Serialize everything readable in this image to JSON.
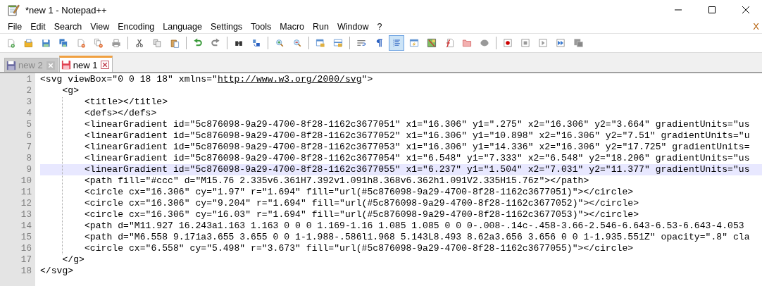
{
  "window": {
    "title": "*new 1 - Notepad++"
  },
  "menu": [
    {
      "label": "File"
    },
    {
      "label": "Edit"
    },
    {
      "label": "Search"
    },
    {
      "label": "View"
    },
    {
      "label": "Encoding"
    },
    {
      "label": "Language"
    },
    {
      "label": "Settings"
    },
    {
      "label": "Tools"
    },
    {
      "label": "Macro"
    },
    {
      "label": "Run"
    },
    {
      "label": "Window"
    },
    {
      "label": "?"
    }
  ],
  "close_document": "X",
  "toolbar": [
    {
      "buttons": [
        {
          "kind": "new",
          "selected": false
        },
        {
          "kind": "open",
          "selected": false
        },
        {
          "kind": "save",
          "selected": false
        },
        {
          "kind": "saveall",
          "selected": false
        },
        {
          "kind": "close",
          "selected": false
        },
        {
          "kind": "closeall",
          "selected": false
        },
        {
          "kind": "print",
          "selected": false
        }
      ]
    },
    {
      "buttons": [
        {
          "kind": "cut",
          "selected": false
        },
        {
          "kind": "copy",
          "selected": false
        },
        {
          "kind": "paste",
          "selected": false
        }
      ]
    },
    {
      "buttons": [
        {
          "kind": "undo",
          "selected": false
        },
        {
          "kind": "redo",
          "selected": false
        }
      ]
    },
    {
      "buttons": [
        {
          "kind": "find",
          "selected": false
        },
        {
          "kind": "replace",
          "selected": false
        }
      ]
    },
    {
      "buttons": [
        {
          "kind": "zoomin",
          "selected": false
        },
        {
          "kind": "zoomout",
          "selected": false
        }
      ]
    },
    {
      "buttons": [
        {
          "kind": "syncv",
          "selected": false
        },
        {
          "kind": "synch",
          "selected": false
        }
      ]
    },
    {
      "buttons": [
        {
          "kind": "wrap",
          "selected": false
        },
        {
          "kind": "pilcrow",
          "selected": false
        },
        {
          "kind": "indent",
          "selected": true
        },
        {
          "kind": "udl",
          "selected": false
        },
        {
          "kind": "docmap",
          "selected": false
        },
        {
          "kind": "funclist",
          "selected": false
        },
        {
          "kind": "folder",
          "selected": false
        },
        {
          "kind": "monitor",
          "selected": false
        }
      ]
    },
    {
      "buttons": [
        {
          "kind": "record",
          "selected": false
        },
        {
          "kind": "stop",
          "selected": false
        },
        {
          "kind": "play",
          "selected": false
        },
        {
          "kind": "playmulti",
          "selected": false
        },
        {
          "kind": "savemacro",
          "selected": false
        }
      ]
    }
  ],
  "tabs": [
    {
      "label": "new 2",
      "selected": false,
      "modified": false
    },
    {
      "label": "new 1",
      "selected": true,
      "modified": true
    }
  ],
  "lines": [
    {
      "number": "1",
      "selected": false,
      "segments": [
        {
          "kind": "code",
          "text": "<svg viewBox=\"0 0 18 18\" xmlns=\""
        },
        {
          "kind": "link",
          "text": "http://www.w3.org/2000/svg"
        },
        {
          "kind": "code",
          "text": "\">"
        }
      ]
    },
    {
      "number": "2",
      "selected": false,
      "segments": [
        {
          "kind": "code",
          "text": "    <g>"
        }
      ]
    },
    {
      "number": "3",
      "selected": false,
      "segments": [
        {
          "kind": "code",
          "text": "        <title></title>"
        }
      ]
    },
    {
      "number": "4",
      "selected": false,
      "segments": [
        {
          "kind": "code",
          "text": "        <defs></defs>"
        }
      ]
    },
    {
      "number": "5",
      "selected": false,
      "segments": [
        {
          "kind": "code",
          "text": "        <linearGradient id=\"5c876098-9a29-4700-8f28-1162c3677051\" x1=\"16.306\" y1=\".275\" x2=\"16.306\" y2=\"3.664\" gradientUnits=\"us"
        }
      ]
    },
    {
      "number": "6",
      "selected": false,
      "segments": [
        {
          "kind": "code",
          "text": "        <linearGradient id=\"5c876098-9a29-4700-8f28-1162c3677052\" x1=\"16.306\" y1=\"10.898\" x2=\"16.306\" y2=\"7.51\" gradientUnits=\"u"
        }
      ]
    },
    {
      "number": "7",
      "selected": false,
      "segments": [
        {
          "kind": "code",
          "text": "        <linearGradient id=\"5c876098-9a29-4700-8f28-1162c3677053\" x1=\"16.306\" y1=\"14.336\" x2=\"16.306\" y2=\"17.725\" gradientUnits="
        }
      ]
    },
    {
      "number": "8",
      "selected": false,
      "segments": [
        {
          "kind": "code",
          "text": "        <linearGradient id=\"5c876098-9a29-4700-8f28-1162c3677054\" x1=\"6.548\" y1=\"7.333\" x2=\"6.548\" y2=\"18.206\" gradientUnits=\"us"
        }
      ]
    },
    {
      "number": "9",
      "selected": true,
      "segments": [
        {
          "kind": "code",
          "text": "        <linearGradient id=\"5c876098-9a29-4700-8f28-1162c3677055\" x1=\"6.237\" y1=\"1.504\" x2=\"7.031\" y2=\"11.377\" gradientUnits=\"us"
        }
      ]
    },
    {
      "number": "10",
      "selected": false,
      "segments": [
        {
          "kind": "code",
          "text": "        <path fill=\"#ccc\" d=\"M15.76 2.335v6.361H7.392v1.091h8.368v6.362h1.091V2.335H15.76z\"></path>"
        }
      ]
    },
    {
      "number": "11",
      "selected": false,
      "segments": [
        {
          "kind": "code",
          "text": "        <circle cx=\"16.306\" cy=\"1.97\" r=\"1.694\" fill=\"url(#5c876098-9a29-4700-8f28-1162c3677051)\"></circle>"
        }
      ]
    },
    {
      "number": "12",
      "selected": false,
      "segments": [
        {
          "kind": "code",
          "text": "        <circle cx=\"16.306\" cy=\"9.204\" r=\"1.694\" fill=\"url(#5c876098-9a29-4700-8f28-1162c3677052)\"></circle>"
        }
      ]
    },
    {
      "number": "13",
      "selected": false,
      "segments": [
        {
          "kind": "code",
          "text": "        <circle cx=\"16.306\" cy=\"16.03\" r=\"1.694\" fill=\"url(#5c876098-9a29-4700-8f28-1162c3677053)\"></circle>"
        }
      ]
    },
    {
      "number": "14",
      "selected": false,
      "segments": [
        {
          "kind": "code",
          "text": "        <path d=\"M11.927 16.243a1.163 1.163 0 0 0 1.169-1.16 1.085 1.085 0 0 0-.008-.14c-.458-3.66-2.546-6.643-6.53-6.643-4.053"
        }
      ]
    },
    {
      "number": "15",
      "selected": false,
      "segments": [
        {
          "kind": "code",
          "text": "        <path d=\"M6.558 9.171a3.655 3.655 0 0 1-1.988-.586l1.968 5.143L8.493 8.62a3.656 3.656 0 0 1-1.935.551Z\" opacity=\".8\" cla"
        }
      ]
    },
    {
      "number": "16",
      "selected": false,
      "segments": [
        {
          "kind": "code",
          "text": "        <circle cx=\"6.558\" cy=\"5.498\" r=\"3.673\" fill=\"url(#5c876098-9a29-4700-8f28-1162c3677055)\"></circle>"
        }
      ]
    },
    {
      "number": "17",
      "selected": false,
      "segments": [
        {
          "kind": "code",
          "text": "    </g>"
        }
      ]
    },
    {
      "number": "18",
      "selected": false,
      "segments": [
        {
          "kind": "code",
          "text": "</svg>"
        }
      ]
    }
  ]
}
